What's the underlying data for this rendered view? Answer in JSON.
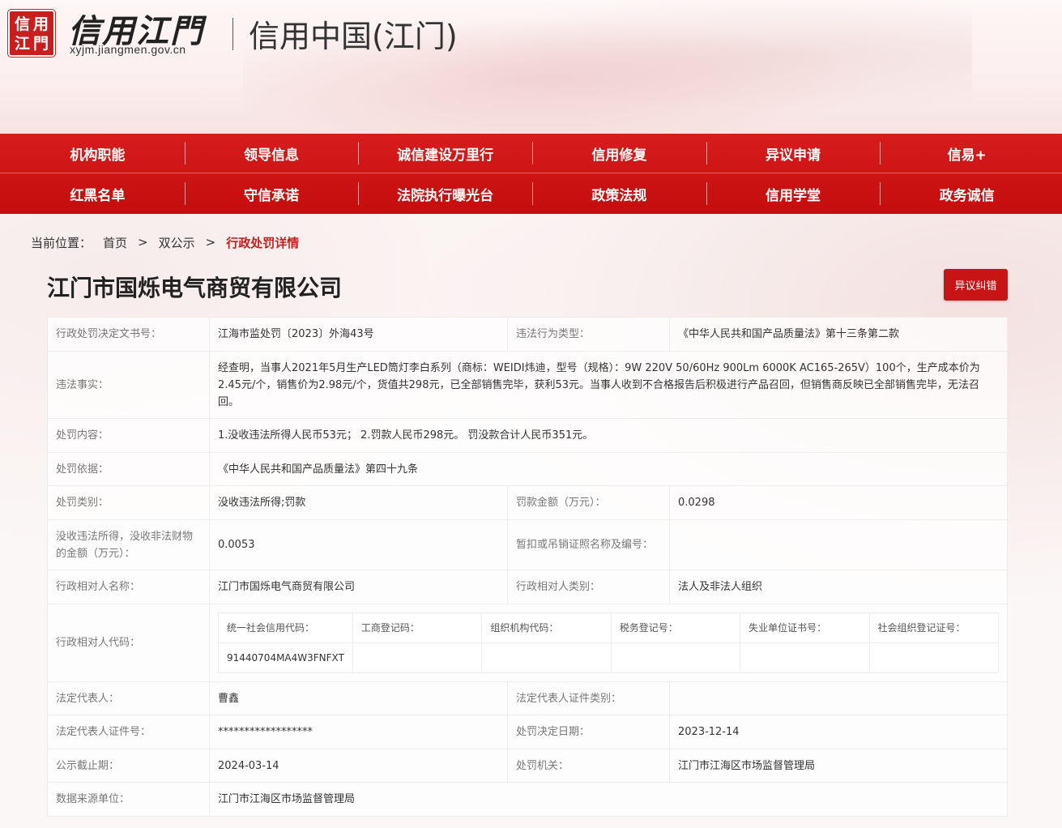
{
  "header": {
    "seal_chars": [
      "信",
      "用",
      "江",
      "門"
    ],
    "logo_text": "信用江門",
    "domain": "xyjm.jiangmen.gov.cn",
    "site_title": "信用中国(江门)"
  },
  "nav": {
    "row1": [
      "机构职能",
      "领导信息",
      "诚信建设万里行",
      "信用修复",
      "异议申请",
      "信易+"
    ],
    "row2": [
      "红黑名单",
      "守信承诺",
      "法院执行曝光台",
      "政策法规",
      "信用学堂",
      "政务诚信"
    ]
  },
  "breadcrumb": {
    "label": "当前位置：",
    "home": "首页",
    "section": "双公示",
    "current": "行政处罚详情",
    "sep": ">"
  },
  "company": {
    "name": "江门市国烁电气商贸有限公司",
    "objection_button": "异议纠错"
  },
  "details": {
    "decision_no_label": "行政处罚决定文书号：",
    "decision_no": "江海市监处罚〔2023〕外海43号",
    "violation_type_label": "违法行为类型：",
    "violation_type": "《中华人民共和国产品质量法》第十三条第二款",
    "facts_label": "违法事实：",
    "facts": "经查明，当事人2021年5月生产LED筒灯李白系列（商标：WEIDI炜迪，型号（规格）：9W 220V 50/60Hz 900Lm 6000K AC165-265V）100个，生产成本价为2.45元/个，销售价为2.98元/个，货值共298元，已全部销售完毕，获利53元。当事人收到不合格报告后积极进行产品召回，但销售商反映已全部销售完毕，无法召回。",
    "content_label": "处罚内容：",
    "content": "1.没收违法所得人民币53元； 2.罚款人民币298元。 罚没款合计人民币351元。",
    "basis_label": "处罚依据：",
    "basis": "《中华人民共和国产品质量法》第四十九条",
    "category_label": "处罚类别：",
    "category": "没收违法所得;罚款",
    "fine_label": "罚款金额（万元）：",
    "fine": "0.0298",
    "confiscated_label": "没收违法所得，没收非法财物的金额（万元）：",
    "confiscated": "0.0053",
    "license_label": "暂扣或吊销证照名称及编号：",
    "license": "",
    "party_name_label": "行政相对人名称：",
    "party_name": "江门市国烁电气商贸有限公司",
    "party_type_label": "行政相对人类别：",
    "party_type": "法人及非法人组织",
    "party_code_label": "行政相对人代码：",
    "codes": {
      "headers": [
        "统一社会信用代码：",
        "工商登记码：",
        "组织机构代码：",
        "税务登记号：",
        "失业单位证书号：",
        "社会组织登记证号："
      ],
      "values": [
        "91440704MA4W3FNFXT",
        "",
        "",
        "",
        "",
        ""
      ]
    },
    "legal_rep_label": "法定代表人：",
    "legal_rep": "曹鑫",
    "legal_id_type_label": "法定代表人证件类别：",
    "legal_id_type": "",
    "legal_id_no_label": "法定代表人证件号：",
    "legal_id_no": "******************",
    "decision_date_label": "处罚决定日期：",
    "decision_date": "2023-12-14",
    "publicity_end_label": "公示截止期：",
    "publicity_end": "2024-03-14",
    "authority_label": "处罚机关：",
    "authority": "江门市江海区市场监督管理局",
    "source_label": "数据来源单位：",
    "source": "江门市江海区市场监督管理局"
  },
  "colors": {
    "brand_red": "#c81e1e",
    "nav_red": "#d71c1c"
  }
}
